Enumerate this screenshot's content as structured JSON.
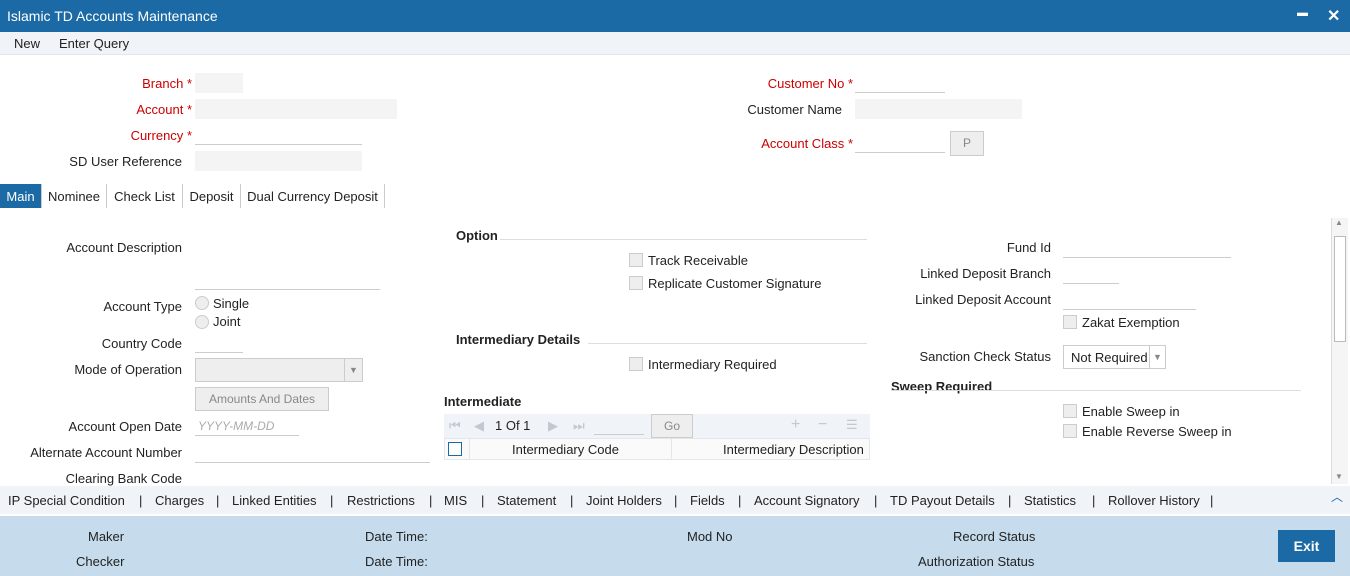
{
  "window": {
    "title": "Islamic TD Accounts Maintenance",
    "minimize": "▬",
    "close": "✕"
  },
  "toolbar": {
    "new": "New",
    "enter_query": "Enter Query"
  },
  "header": {
    "branch": "Branch",
    "account": "Account",
    "currency": "Currency",
    "sd_user_reference": "SD User Reference",
    "customer_no": "Customer No",
    "customer_name": "Customer Name",
    "account_class": "Account Class",
    "required_mark": "*",
    "p_button": "P"
  },
  "tabs": [
    "Main",
    "Nominee",
    "Check List",
    "Deposit",
    "Dual Currency Deposit"
  ],
  "main": {
    "account_description": "Account Description",
    "account_type": "Account Type",
    "single": "Single",
    "joint": "Joint",
    "country_code": "Country Code",
    "mode_of_operation": "Mode of Operation",
    "amounts_and_dates": "Amounts And Dates",
    "account_open_date": "Account Open Date",
    "date_placeholder": "YYYY-MM-DD",
    "alternate_account_number": "Alternate Account Number",
    "clearing_bank_code": "Clearing Bank Code",
    "option": "Option",
    "track_receivable": "Track Receivable",
    "replicate_customer_signature": "Replicate Customer Signature",
    "intermediary_details": "Intermediary Details",
    "intermediary_required": "Intermediary Required",
    "intermediate": "Intermediate",
    "pager": "1 Of 1",
    "go": "Go",
    "col_code": "Intermediary Code",
    "col_desc": "Intermediary Description",
    "fund_id": "Fund Id",
    "linked_deposit_branch": "Linked Deposit Branch",
    "linked_deposit_account": "Linked Deposit Account",
    "zakat_exemption": "Zakat Exemption",
    "sanction_check_status": "Sanction Check Status",
    "sanction_value": "Not Required",
    "sweep_required": "Sweep Required",
    "enable_sweep_in": "Enable Sweep in",
    "enable_reverse_sweep_in": "Enable Reverse Sweep in"
  },
  "bottom_tabs": [
    "IP Special Condition",
    "Charges",
    "Linked Entities",
    "Restrictions",
    "MIS",
    "Statement",
    "Joint Holders",
    "Fields",
    "Account Signatory",
    "TD Payout Details",
    "Statistics",
    "Rollover History"
  ],
  "separator": "|",
  "footer": {
    "maker": "Maker",
    "checker": "Checker",
    "date_time": "Date Time:",
    "mod_no": "Mod No",
    "record_status": "Record Status",
    "authorization_status": "Authorization Status",
    "exit": "Exit"
  }
}
